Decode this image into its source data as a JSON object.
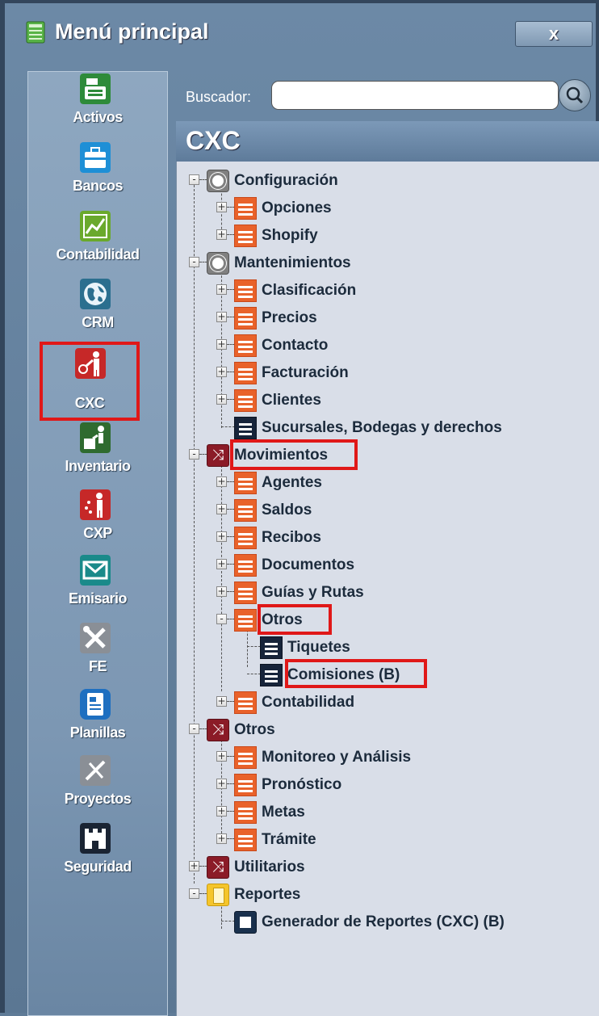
{
  "window": {
    "title": "Menú principal",
    "close_label": "x"
  },
  "sidebar": {
    "items": [
      {
        "label": "Activos",
        "icon": "cash-register-icon",
        "color": "#2e8b3a"
      },
      {
        "label": "Bancos",
        "icon": "briefcase-icon",
        "color": "#1e8fd6"
      },
      {
        "label": "Contabilidad",
        "icon": "chart-icon",
        "color": "#6aa92c"
      },
      {
        "label": "CRM",
        "icon": "globe-icon",
        "color": "#2b6f8f"
      },
      {
        "label": "CXC",
        "icon": "person-collecting-icon",
        "color": "#c62828"
      },
      {
        "label": "Inventario",
        "icon": "person-box-icon",
        "color": "#2f6b2f"
      },
      {
        "label": "CXP",
        "icon": "person-paying-icon",
        "color": "#c62828"
      },
      {
        "label": "Emisario",
        "icon": "envelope-icon",
        "color": "#1a8a8a"
      },
      {
        "label": "FE",
        "icon": "tools-icon",
        "color": "#8a8f96"
      },
      {
        "label": "Planillas",
        "icon": "document-icon",
        "color": "#1e6fc0"
      },
      {
        "label": "Proyectos",
        "icon": "drafting-icon",
        "color": "#8a8f96"
      },
      {
        "label": "Seguridad",
        "icon": "castle-icon",
        "color": "#1a2433"
      }
    ]
  },
  "search": {
    "label": "Buscador:",
    "value": "",
    "placeholder": ""
  },
  "module": {
    "title": "CXC"
  },
  "tree": [
    {
      "label": "Configuración",
      "expander": "-",
      "icon": "gear"
    },
    {
      "label": "Opciones",
      "expander": "+",
      "icon": "list"
    },
    {
      "label": "Shopify",
      "expander": "+",
      "icon": "list"
    },
    {
      "label": "Mantenimientos",
      "expander": "-",
      "icon": "gear"
    },
    {
      "label": "Clasificación",
      "expander": "+",
      "icon": "list"
    },
    {
      "label": "Precios",
      "expander": "+",
      "icon": "list"
    },
    {
      "label": "Contacto",
      "expander": "+",
      "icon": "list"
    },
    {
      "label": "Facturación",
      "expander": "+",
      "icon": "list"
    },
    {
      "label": "Clientes",
      "expander": "+",
      "icon": "list"
    },
    {
      "label": "Sucursales, Bodegas y derechos",
      "expander": "",
      "icon": "dark-list"
    },
    {
      "label": "Movimientos",
      "expander": "-",
      "icon": "shuffle"
    },
    {
      "label": "Agentes",
      "expander": "+",
      "icon": "list"
    },
    {
      "label": "Saldos",
      "expander": "+",
      "icon": "list"
    },
    {
      "label": "Recibos",
      "expander": "+",
      "icon": "list"
    },
    {
      "label": "Documentos",
      "expander": "+",
      "icon": "list"
    },
    {
      "label": "Guías y Rutas",
      "expander": "+",
      "icon": "list"
    },
    {
      "label": "Otros",
      "expander": "-",
      "icon": "list"
    },
    {
      "label": "Tiquetes",
      "expander": "",
      "icon": "dark-list"
    },
    {
      "label": "Comisiones (B)",
      "expander": "",
      "icon": "dark-list"
    },
    {
      "label": "Contabilidad",
      "expander": "+",
      "icon": "list"
    },
    {
      "label": "Otros",
      "expander": "-",
      "icon": "shuffle"
    },
    {
      "label": "Monitoreo y Análisis",
      "expander": "+",
      "icon": "list"
    },
    {
      "label": "Pronóstico",
      "expander": "+",
      "icon": "list"
    },
    {
      "label": "Metas",
      "expander": "+",
      "icon": "list"
    },
    {
      "label": "Trámite",
      "expander": "+",
      "icon": "list"
    },
    {
      "label": "Utilitarios",
      "expander": "+",
      "icon": "shuffle"
    },
    {
      "label": "Reportes",
      "expander": "-",
      "icon": "report"
    },
    {
      "label": "Generador de Reportes (CXC) (B)",
      "expander": "",
      "icon": "printer"
    }
  ]
}
